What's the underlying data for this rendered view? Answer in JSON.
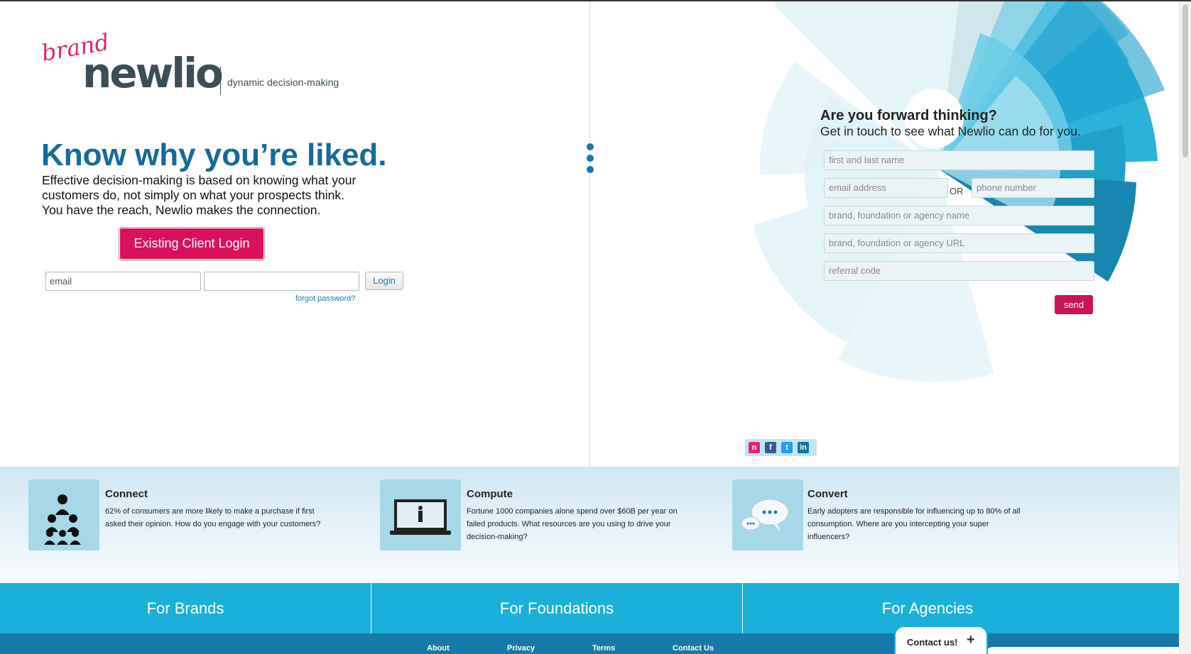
{
  "logo": {
    "brand_word": "brand",
    "name": "newlio",
    "tagline": "dynamic decision-making"
  },
  "hero": {
    "headline": "Know why you’re liked.",
    "intro_lines": [
      "Effective decision-making is based on knowing what your",
      "customers do, not simply on what your prospects think.",
      "You have the reach, Newlio makes the connection."
    ],
    "client_login_label": "Existing Client Login"
  },
  "login": {
    "email_value": "email",
    "password_value": "",
    "button_label": "Login",
    "forgot_label": "forgot password?"
  },
  "contact_form": {
    "title": "Are you forward thinking?",
    "subtitle": "Get in touch to see what Newlio can do for you.",
    "name_placeholder": "first and last name",
    "email_placeholder": "email address",
    "or_label": "OR",
    "phone_placeholder": "phone number",
    "org_name_placeholder": "brand, foundation or agency name",
    "org_url_placeholder": "brand, foundation or agency URL",
    "referral_placeholder": "referral code",
    "send_label": "send"
  },
  "social": [
    {
      "icon": "newlio-icon",
      "glyph": "n",
      "color": "#e0266f"
    },
    {
      "icon": "facebook-icon",
      "glyph": "f",
      "color": "#3b5998"
    },
    {
      "icon": "twitter-icon",
      "glyph": "t",
      "color": "#1da1f2"
    },
    {
      "icon": "linkedin-icon",
      "glyph": "in",
      "color": "#0e76a8"
    }
  ],
  "features": [
    {
      "icon": "people-hierarchy-icon",
      "title": "Connect",
      "text": "62% of consumers are more likely to make a purchase if first asked their opinion. How do you engage with your customers?"
    },
    {
      "icon": "laptop-icon",
      "title": "Compute",
      "text": "Fortune 1000 companies alone spend over $60B per year on failed products. What resources are you using to drive your decision-making?"
    },
    {
      "icon": "speech-bubbles-icon",
      "title": "Convert",
      "text": "Early adopters are responsible for influencing up to 80% of all consumption. Where are you intercepting your super influencers?"
    }
  ],
  "categories": [
    "For Brands",
    "For Foundations",
    "For Agencies"
  ],
  "footer": {
    "links": [
      "About",
      "Privacy",
      "Terms",
      "Contact Us"
    ],
    "contact_tab_label": "Contact us!",
    "contact_tab_icon": "plus-icon"
  },
  "colors": {
    "brand_pink": "#d9115d",
    "brand_blue": "#156a9a",
    "category_bar": "#1ab0d9",
    "footer_bar": "#157aa7"
  }
}
